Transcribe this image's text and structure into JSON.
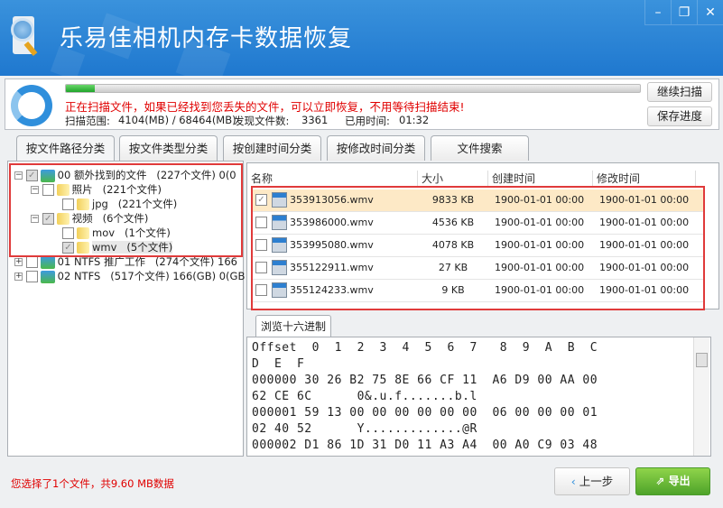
{
  "window": {
    "title": "乐易佳相机内存卡数据恢复",
    "minimize": "–",
    "restore": "❐",
    "close": "✕"
  },
  "scan": {
    "progress_percent": 5,
    "message": "正在扫描文件，如果已经找到您丢失的文件，可以立即恢复，不用等待扫描结束!",
    "range_label": "扫描范围:",
    "range_value": "4104(MB) / 68464(MB)",
    "found_label": "发现文件数:",
    "found_value": "3361",
    "elapsed_label": "已用时间:",
    "elapsed_value": "01:32",
    "continue_button": "继续扫描",
    "save_button": "保存进度"
  },
  "tabs": [
    {
      "label": "按文件路径分类",
      "active": true
    },
    {
      "label": "按文件类型分类"
    },
    {
      "label": "按创建时间分类"
    },
    {
      "label": "按修改时间分类"
    },
    {
      "label": "文件搜索"
    }
  ],
  "tree": [
    {
      "label": "00  额外找到的文件",
      "count": "(227个文件)  0(0",
      "checked": "partial",
      "expanded": true
    },
    {
      "label": "照片",
      "count": "(221个文件)",
      "checked": false,
      "expanded": true
    },
    {
      "label": "jpg",
      "count": "(221个文件)",
      "checked": false
    },
    {
      "label": "视频",
      "count": "(6个文件)",
      "checked": "partial",
      "expanded": true
    },
    {
      "label": "mov",
      "count": "(1个文件)",
      "checked": false
    },
    {
      "label": "wmv",
      "count": "(5个文件)",
      "checked": true,
      "selected": true
    },
    {
      "label": "01  NTFS  推广工作",
      "count": "(274个文件)  166",
      "checked": false
    },
    {
      "label": "02  NTFS",
      "count": "(517个文件)  166(GB)  0(GB",
      "checked": false
    }
  ],
  "list": {
    "columns": [
      "名称",
      "大小",
      "创建时间",
      "修改时间"
    ],
    "rows": [
      {
        "name": "353913056.wmv",
        "size": "9833 KB",
        "created": "1900-01-01  00:00",
        "modified": "1900-01-01  00:00",
        "checked": true
      },
      {
        "name": "353986000.wmv",
        "size": "4536 KB",
        "created": "1900-01-01  00:00",
        "modified": "1900-01-01  00:00",
        "checked": false
      },
      {
        "name": "353995080.wmv",
        "size": "4078 KB",
        "created": "1900-01-01  00:00",
        "modified": "1900-01-01  00:00",
        "checked": false
      },
      {
        "name": "355122911.wmv",
        "size": "27 KB",
        "created": "1900-01-01  00:00",
        "modified": "1900-01-01  00:00",
        "checked": false
      },
      {
        "name": "355124233.wmv",
        "size": "9 KB",
        "created": "1900-01-01  00:00",
        "modified": "1900-01-01  00:00",
        "checked": false
      }
    ]
  },
  "hex": {
    "tab": "浏览十六进制",
    "lines": [
      "Offset  0  1  2  3  4  5  6  7   8  9  A  B  C",
      "D  E  F",
      "000000 30 26 B2 75 8E 66 CF 11  A6 D9 00 AA 00",
      "62 CE 6C      0&.u.f.......b.l",
      "000001 59 13 00 00 00 00 00 00  06 00 00 00 01",
      "02 40 52      Y.............@R",
      "000002 D1 86 1D 31 D0 11 A3 A4  00 A0 C9 03 48"
    ]
  },
  "footer": {
    "status": "您选择了1个文件，共9.60 MB数据",
    "back_button": "上一步",
    "back_icon": "chevron-left",
    "export_button": "导出",
    "export_icon": "export-arrow"
  }
}
